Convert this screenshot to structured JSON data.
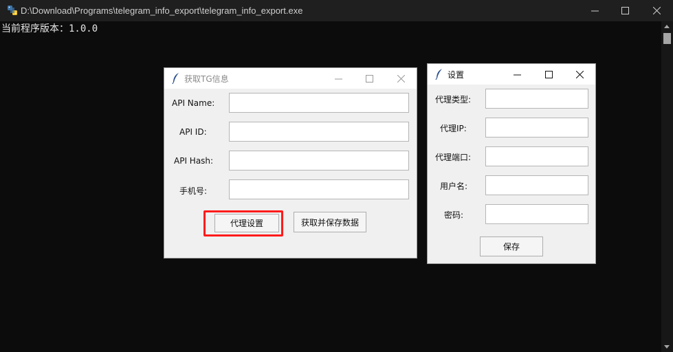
{
  "console": {
    "title": "D:\\Download\\Programs\\telegram_info_export\\telegram_info_export.exe",
    "output_line": "当前程序版本：1.0.0",
    "controls": {
      "minimize": "minimize-icon",
      "maximize": "maximize-icon",
      "close": "close-icon"
    }
  },
  "tg_dialog": {
    "title": "获取TG信息",
    "fields": [
      {
        "label": "API Name:",
        "value": ""
      },
      {
        "label": "API ID:",
        "value": ""
      },
      {
        "label": "API Hash:",
        "value": ""
      },
      {
        "label": "手机号:",
        "value": ""
      }
    ],
    "buttons": {
      "proxy_settings": "代理设置",
      "fetch_save": "获取并保存数据"
    },
    "highlight_color": "#ff1a1a"
  },
  "settings_dialog": {
    "title": "设置",
    "fields": [
      {
        "label": "代理类型:",
        "value": ""
      },
      {
        "label": "代理IP:",
        "value": ""
      },
      {
        "label": "代理端口:",
        "value": ""
      },
      {
        "label": "用户名:",
        "value": ""
      },
      {
        "label": "密码:",
        "value": ""
      }
    ],
    "buttons": {
      "save": "保存"
    }
  }
}
